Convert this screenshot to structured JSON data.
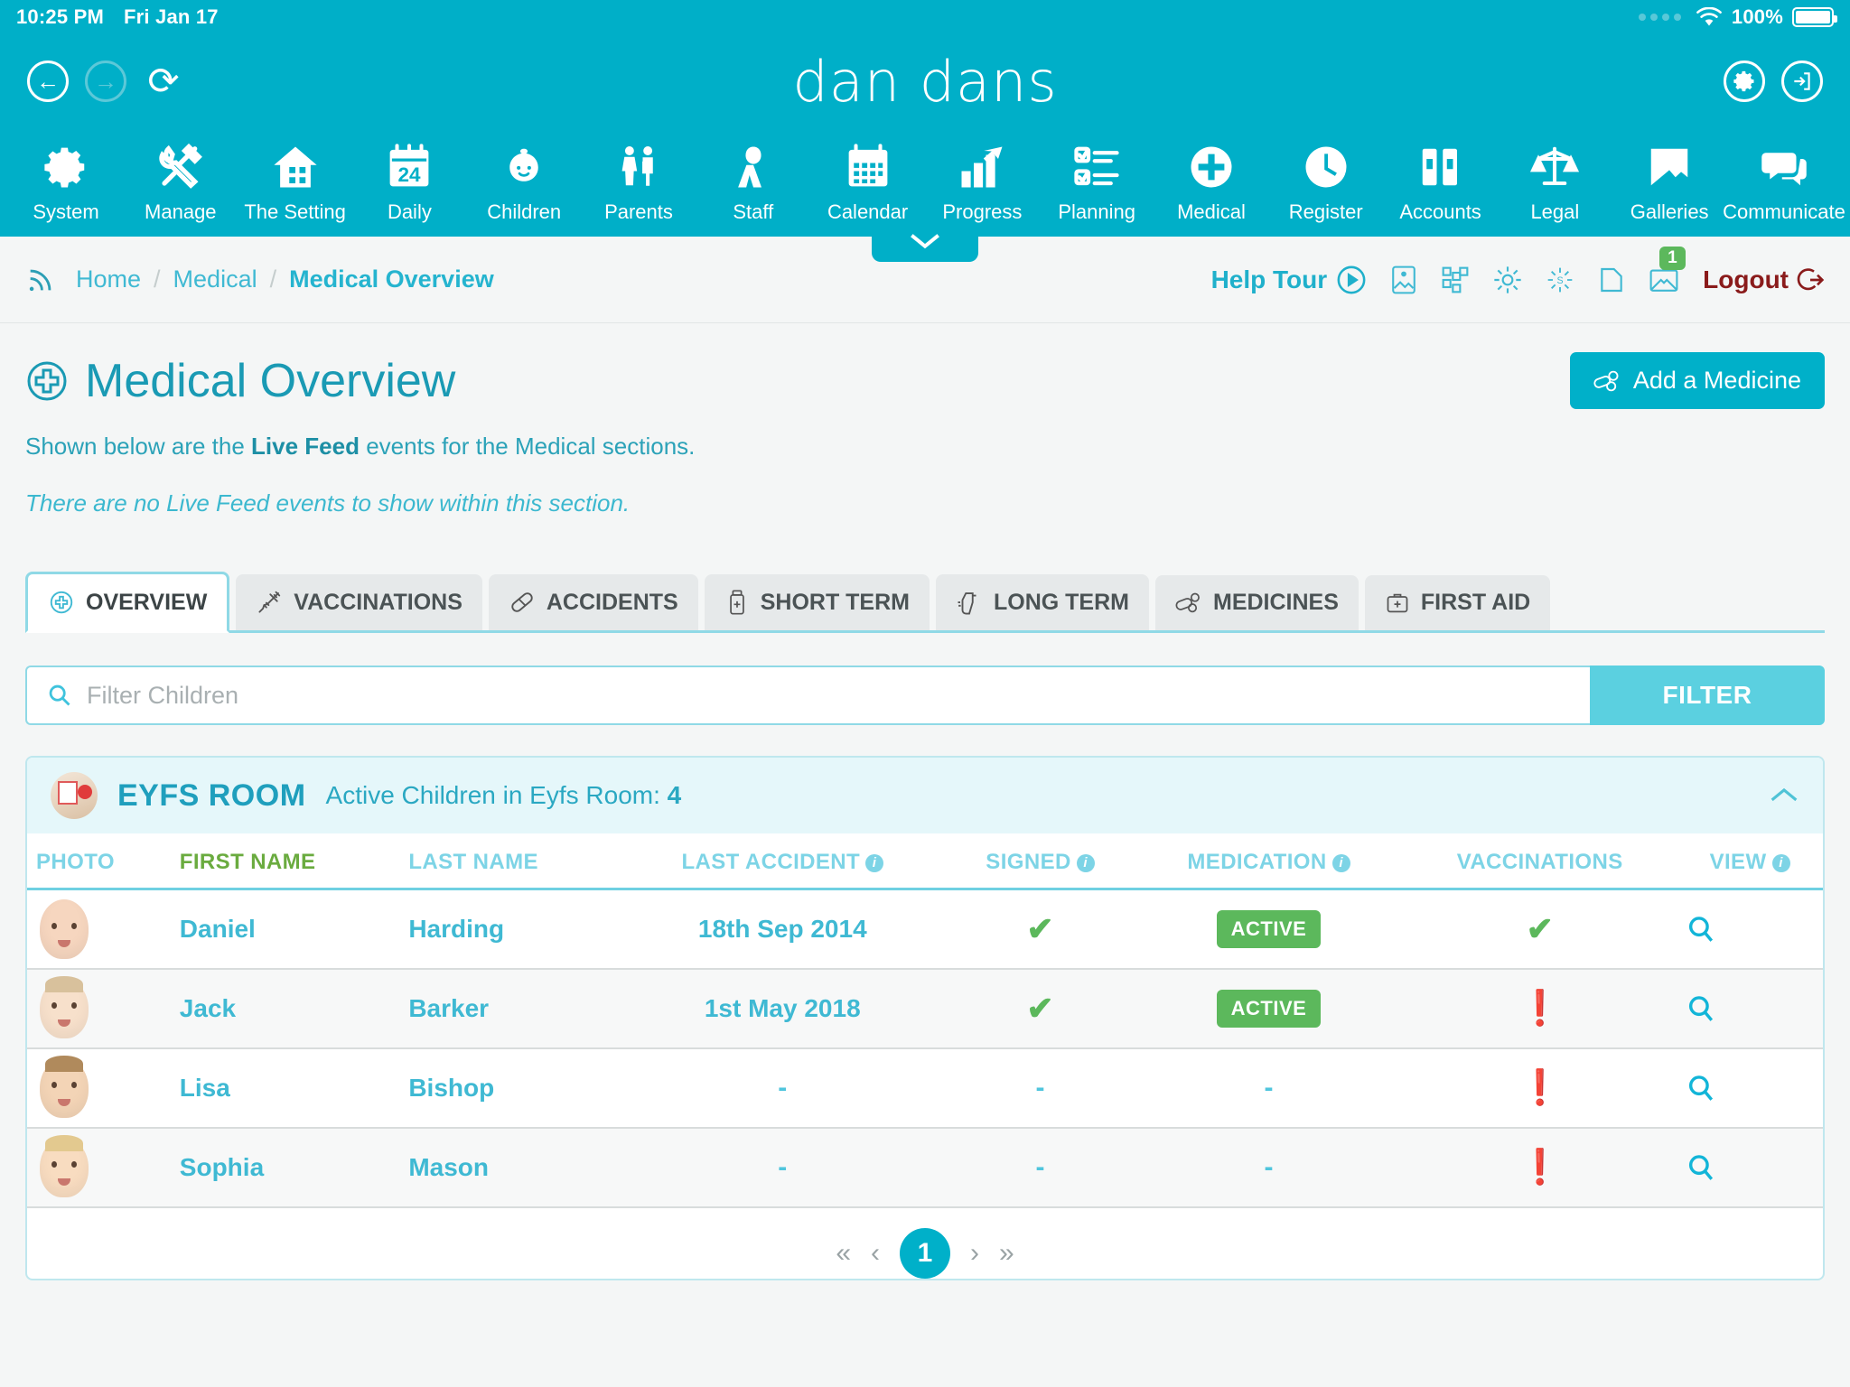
{
  "statusbar": {
    "time": "10:25 PM",
    "date": "Fri Jan 17",
    "battery": "100%"
  },
  "header": {
    "brand": "dan dans",
    "back_icon": "back-arrow-icon",
    "forward_icon": "forward-arrow-icon",
    "reload_icon": "reload-icon",
    "settings_icon": "gear-icon",
    "exit_icon": "exit-icon"
  },
  "mainnav": [
    {
      "label": "System",
      "icon": "gear-icon"
    },
    {
      "label": "Manage",
      "icon": "tools-icon"
    },
    {
      "label": "The Setting",
      "icon": "house-icon"
    },
    {
      "label": "Daily",
      "icon": "calendar-24-icon"
    },
    {
      "label": "Children",
      "icon": "baby-face-icon"
    },
    {
      "label": "Parents",
      "icon": "parents-icon"
    },
    {
      "label": "Staff",
      "icon": "staff-person-icon"
    },
    {
      "label": "Calendar",
      "icon": "calendar-icon"
    },
    {
      "label": "Progress",
      "icon": "bar-chart-arrow-icon"
    },
    {
      "label": "Planning",
      "icon": "checklist-icon"
    },
    {
      "label": "Medical",
      "icon": "medical-cross-icon"
    },
    {
      "label": "Register",
      "icon": "clock-icon"
    },
    {
      "label": "Accounts",
      "icon": "binders-icon"
    },
    {
      "label": "Legal",
      "icon": "scales-icon"
    },
    {
      "label": "Galleries",
      "icon": "photo-frame-icon"
    },
    {
      "label": "Communicate",
      "icon": "speech-bubbles-icon"
    }
  ],
  "breadcrumb": {
    "rss_icon": "rss-icon",
    "items": [
      "Home",
      "Medical",
      "Medical Overview"
    ],
    "separator": "/",
    "help_tour": "Help Tour",
    "logout": "Logout",
    "mail_badge": "1",
    "icons": [
      "photo-card-icon",
      "grid-blocks-icon",
      "sun-icon",
      "scatter-icon",
      "folder-icon",
      "mail-icon"
    ]
  },
  "main": {
    "title": "Medical Overview",
    "title_icon": "medical-cross-circle-icon",
    "add_button": {
      "label": "Add a Medicine",
      "icon": "pills-icon"
    },
    "desc_pre": "Shown below are the ",
    "desc_bold": "Live Feed",
    "desc_post": " events for the Medical sections.",
    "no_events": "There are no Live Feed events to show within this section.",
    "tabs": [
      {
        "label": "OVERVIEW",
        "icon": "medical-cross-circle-icon",
        "active": true
      },
      {
        "label": "VACCINATIONS",
        "icon": "syringe-icon",
        "active": false
      },
      {
        "label": "ACCIDENTS",
        "icon": "plaster-icon",
        "active": false
      },
      {
        "label": "SHORT TERM",
        "icon": "medicine-bottle-icon",
        "active": false
      },
      {
        "label": "LONG TERM",
        "icon": "inhaler-icon",
        "active": false
      },
      {
        "label": "MEDICINES",
        "icon": "pills-icon",
        "active": false
      },
      {
        "label": "FIRST AID",
        "icon": "first-aid-kit-icon",
        "active": false
      }
    ],
    "filter": {
      "placeholder": "Filter Children",
      "value": "",
      "button": "FILTER",
      "search_icon": "search-icon"
    },
    "room": {
      "name": "EYFS ROOM",
      "count_label": "Active Children in Eyfs Room:",
      "count": "4",
      "collapse_icon": "chevron-up-icon"
    },
    "table": {
      "columns": [
        {
          "label": "PHOTO",
          "info": false,
          "sorted": false,
          "align": "left"
        },
        {
          "label": "FIRST NAME",
          "info": false,
          "sorted": true,
          "align": "left"
        },
        {
          "label": "LAST NAME",
          "info": false,
          "sorted": false,
          "align": "left"
        },
        {
          "label": "LAST ACCIDENT",
          "info": true,
          "sorted": false,
          "align": "center"
        },
        {
          "label": "SIGNED",
          "info": true,
          "sorted": false,
          "align": "center"
        },
        {
          "label": "MEDICATION",
          "info": true,
          "sorted": false,
          "align": "center"
        },
        {
          "label": "VACCINATIONS",
          "info": false,
          "sorted": false,
          "align": "center"
        },
        {
          "label": "VIEW",
          "info": true,
          "sorted": false,
          "align": "center"
        }
      ],
      "rows": [
        {
          "first_name": "Daniel",
          "last_name": "Harding",
          "last_accident": "18th Sep 2014",
          "signed": "check",
          "medication": "ACTIVE",
          "vaccinations": "check",
          "skin": "#f6d6bf",
          "hair": "none",
          "view_icon": "magnifier-icon"
        },
        {
          "first_name": "Jack",
          "last_name": "Barker",
          "last_accident": "1st May 2018",
          "signed": "check",
          "medication": "ACTIVE",
          "vaccinations": "alert",
          "skin": "#f7e0cb",
          "hair": "#d8c19c",
          "view_icon": "magnifier-icon"
        },
        {
          "first_name": "Lisa",
          "last_name": "Bishop",
          "last_accident": "-",
          "signed": "-",
          "medication": "-",
          "vaccinations": "alert",
          "skin": "#f3d4b6",
          "hair": "#b08a5c",
          "view_icon": "magnifier-icon"
        },
        {
          "first_name": "Sophia",
          "last_name": "Mason",
          "last_accident": "-",
          "signed": "-",
          "medication": "-",
          "vaccinations": "alert",
          "skin": "#f8dcc0",
          "hair": "#e3c98f",
          "view_icon": "magnifier-icon"
        }
      ]
    },
    "pager": {
      "first": "«",
      "prev": "‹",
      "current": "1",
      "next": "›",
      "last": "»"
    }
  },
  "colors": {
    "brand": "#00afc8",
    "accent": "#3fb9d3",
    "green": "#5cb85c",
    "sorted_green": "#6aab3f",
    "alert_red": "#8f1010",
    "logout_red": "#8a1b1b"
  }
}
